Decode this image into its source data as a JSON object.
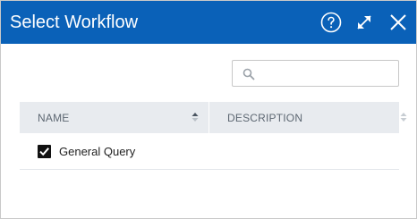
{
  "dialog": {
    "title": "Select Workflow",
    "header_color": "#0a61b8",
    "buttons": {
      "help_icon": "question-circle",
      "expand_icon": "diagonal-expand-arrows",
      "close_icon": "x-close"
    }
  },
  "search": {
    "value": "",
    "placeholder": "",
    "icon": "magnifier"
  },
  "table": {
    "columns": [
      {
        "label": "NAME",
        "sortable": true
      },
      {
        "label": "DESCRIPTION",
        "sortable": true
      }
    ],
    "rows": [
      {
        "name": "General Query",
        "description": "",
        "checked": true
      }
    ]
  }
}
